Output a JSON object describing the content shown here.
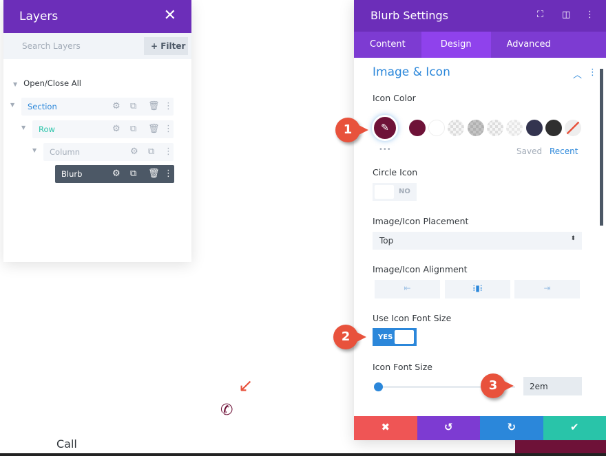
{
  "layers": {
    "title": "Layers",
    "search_placeholder": "Search Layers",
    "filter_label": "+ Filter",
    "open_close_all": "Open/Close All",
    "items": [
      {
        "label": "Section",
        "color": "#2b87da"
      },
      {
        "label": "Row",
        "color": "#29c4a9"
      },
      {
        "label": "Column",
        "color": "#a3acb8"
      },
      {
        "label": "Blurb",
        "color": "#ffffff"
      }
    ]
  },
  "settings": {
    "title": "Blurb Settings",
    "tabs": [
      {
        "label": "Content"
      },
      {
        "label": "Design",
        "active": true
      },
      {
        "label": "Advanced"
      }
    ],
    "section_title": "Image & Icon",
    "icon_color": {
      "label": "Icon Color",
      "selected": "#6e1238",
      "swatches": [
        "#6e1238",
        "#ffffff",
        "transparent",
        "transparent",
        "transparent",
        "transparent",
        "#33344f",
        "#2f2f2f",
        "none"
      ],
      "saved_label": "Saved",
      "recent_label": "Recent",
      "more": "•••"
    },
    "circle_icon": {
      "label": "Circle Icon",
      "value": "NO"
    },
    "placement": {
      "label": "Image/Icon Placement",
      "value": "Top"
    },
    "alignment": {
      "label": "Image/Icon Alignment",
      "options": [
        "left",
        "center",
        "right"
      ],
      "selected": "center"
    },
    "use_icon_font_size": {
      "label": "Use Icon Font Size",
      "value": "YES"
    },
    "icon_font_size": {
      "label": "Icon Font Size",
      "value": "2em",
      "slider_fraction": 0
    }
  },
  "annotations": [
    "1",
    "2",
    "3"
  ],
  "canvas": {
    "blurb_title": "Call",
    "icon": "phone-icon"
  }
}
